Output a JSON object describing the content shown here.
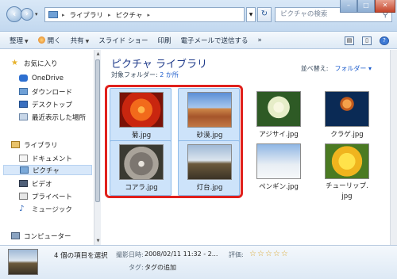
{
  "address": {
    "crumbs": [
      "ライブラリ",
      "ピクチャ"
    ],
    "search_placeholder": "ピクチャの検索"
  },
  "toolbar": {
    "organize": "整理",
    "open": "開く",
    "share": "共有",
    "slideshow": "スライド ショー",
    "print": "印刷",
    "email": "電子メールで送信する",
    "more": "»"
  },
  "sidebar": {
    "favorites": "お気に入り",
    "onedrive": "OneDrive",
    "downloads": "ダウンロード",
    "desktop": "デスクトップ",
    "recent": "最近表示した場所",
    "libraries": "ライブラリ",
    "documents": "ドキュメント",
    "pictures": "ピクチャ",
    "videos": "ビデオ",
    "private": "プライベート",
    "music": "ミュージック",
    "computer": "コンピューター"
  },
  "main": {
    "title": "ピクチャ ライブラリ",
    "subtitle_prefix": "対象フォルダー:",
    "subtitle_link": "2 か所",
    "arrange_label": "並べ替え:",
    "arrange_value": "フォルダー ▾",
    "items": [
      {
        "name": "菊.jpg",
        "selected": true
      },
      {
        "name": "砂漠.jpg",
        "selected": true
      },
      {
        "name": "アジサイ.jpg",
        "selected": false
      },
      {
        "name": "クラゲ.jpg",
        "selected": false
      },
      {
        "name": "コアラ.jpg",
        "selected": true
      },
      {
        "name": "灯台.jpg",
        "selected": true
      },
      {
        "name": "ペンギン.jpg",
        "selected": false
      },
      {
        "name": "チューリップ.",
        "name2": "jpg",
        "selected": false
      }
    ]
  },
  "details": {
    "count": "4 個の項目を選択",
    "date_label": "撮影日時:",
    "date_value": "2008/02/11 11:32 - 2...",
    "rating_label": "評価:",
    "tags_label": "タグ:",
    "tags_value": "タグの追加"
  },
  "colors": {
    "accent": "#1e3a8a",
    "selection_highlight": "#e0201c",
    "link": "#1c5ccc"
  }
}
